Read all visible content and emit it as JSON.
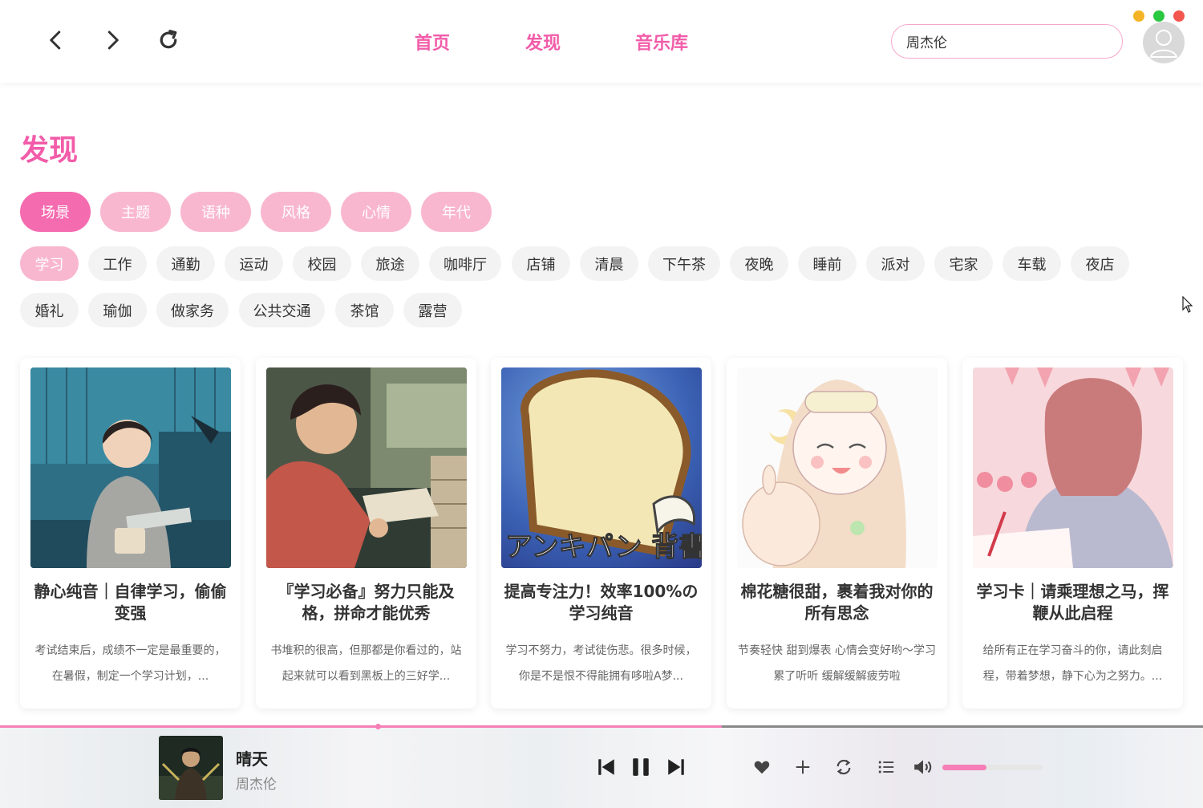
{
  "window": {
    "dots": [
      {
        "name": "minimize",
        "color": "#f5b425"
      },
      {
        "name": "maximize",
        "color": "#2ac840"
      },
      {
        "name": "close",
        "color": "#f2564e"
      }
    ]
  },
  "header": {
    "tabs": [
      "首页",
      "发现",
      "音乐库"
    ],
    "search_value": "周杰伦",
    "accent": "#f25ca9"
  },
  "page": {
    "title": "发现"
  },
  "categories": [
    {
      "label": "场景",
      "active": true
    },
    {
      "label": "主题",
      "active": false
    },
    {
      "label": "语种",
      "active": false
    },
    {
      "label": "风格",
      "active": false
    },
    {
      "label": "心情",
      "active": false
    },
    {
      "label": "年代",
      "active": false
    }
  ],
  "tags": [
    {
      "label": "学习",
      "active": true
    },
    {
      "label": "工作",
      "active": false
    },
    {
      "label": "通勤",
      "active": false
    },
    {
      "label": "运动",
      "active": false
    },
    {
      "label": "校园",
      "active": false
    },
    {
      "label": "旅途",
      "active": false
    },
    {
      "label": "咖啡厅",
      "active": false
    },
    {
      "label": "店铺",
      "active": false
    },
    {
      "label": "清晨",
      "active": false
    },
    {
      "label": "下午茶",
      "active": false
    },
    {
      "label": "夜晚",
      "active": false
    },
    {
      "label": "睡前",
      "active": false
    },
    {
      "label": "派对",
      "active": false
    },
    {
      "label": "宅家",
      "active": false
    },
    {
      "label": "车载",
      "active": false
    },
    {
      "label": "夜店",
      "active": false
    },
    {
      "label": "婚礼",
      "active": false
    },
    {
      "label": "瑜伽",
      "active": false
    },
    {
      "label": "做家务",
      "active": false
    },
    {
      "label": "公共交通",
      "active": false
    },
    {
      "label": "茶馆",
      "active": false
    },
    {
      "label": "露营",
      "active": false
    }
  ],
  "playlists": [
    {
      "title": "静心纯音｜自律学习，偷偷变强",
      "desc": "考试结束后，成绩不一定是最重要的，在暑假，制定一个学习计划，...",
      "cover_art": "girl-studying-at-desk-illustration"
    },
    {
      "title": "『学习必备』努力只能及格，拼命才能优秀",
      "desc": "书堆积的很高，但那都是你看过的，站起来就可以看到黑板上的三好学...",
      "cover_art": "boy-writing-at-desk-illustration"
    },
    {
      "title": "提高专注力！效率100%の学习纯音",
      "desc": "学习不努力，考试徒伤悲。很多时候，你是不是恨不得能拥有哆啦A梦...",
      "cover_art": "memory-bread-cartoon",
      "cover_text": "アンキパン 背書吐司"
    },
    {
      "title": "棉花糖很甜，裹着我对你的所有思念",
      "desc": "节奏轻快 甜到爆表 心情会变好哟～学习累了听听 缓解缓解疲劳啦",
      "cover_art": "smiling-girl-with-bunny-illustration"
    },
    {
      "title": "学习卡｜请乘理想之马，挥鞭从此启程",
      "desc": "给所有正在学习奋斗的你，请此刻启程，带着梦想，静下心为之努力。...",
      "cover_art": "pink-girl-writing-illustration"
    }
  ],
  "player": {
    "song_title": "晴天",
    "artist": "周杰伦",
    "progress": 0.6,
    "volume": 0.44,
    "controls": [
      "prev-icon",
      "pause-icon",
      "next-icon",
      "heart-icon",
      "plus-icon",
      "repeat-icon",
      "playlist-icon",
      "volume-icon"
    ]
  }
}
